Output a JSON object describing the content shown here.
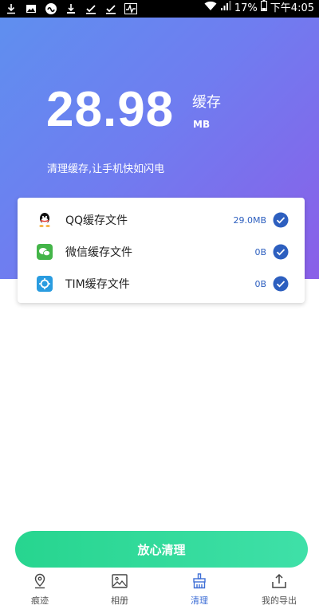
{
  "status_bar": {
    "battery": "17%",
    "time": "下午4:05"
  },
  "hero": {
    "amount": "28.98",
    "label": "缓存",
    "unit": "MB",
    "slogan": "清理缓存,让手机快如闪电"
  },
  "cache_list": [
    {
      "label": "QQ缓存文件",
      "size": "29.0MB",
      "icon": "qq-icon",
      "checked": true
    },
    {
      "label": "微信缓存文件",
      "size": "0B",
      "icon": "wechat-icon",
      "checked": true
    },
    {
      "label": "TIM缓存文件",
      "size": "0B",
      "icon": "tim-icon",
      "checked": true
    }
  ],
  "clean_button": {
    "label": "放心清理"
  },
  "bottom_nav": [
    {
      "label": "痕迹",
      "icon": "location-pin-icon",
      "active": false
    },
    {
      "label": "相册",
      "icon": "image-icon",
      "active": false
    },
    {
      "label": "清理",
      "icon": "broom-icon",
      "active": true
    },
    {
      "label": "我的导出",
      "icon": "export-icon",
      "active": false
    }
  ],
  "colors": {
    "accent": "#3f6fd6",
    "check": "#2d5fbf",
    "button_start": "#27d58f",
    "button_end": "#3fe0a8",
    "gradient_start": "#5f8fef",
    "gradient_end": "#8a5fe8"
  }
}
